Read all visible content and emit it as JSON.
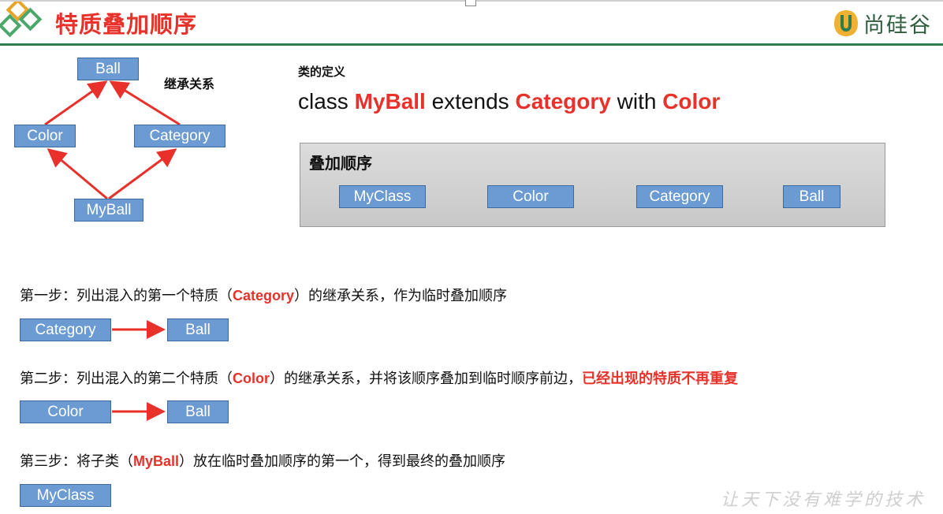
{
  "header": {
    "title": "特质叠加顺序",
    "brand": "尚硅谷"
  },
  "inheritance": {
    "label": "继承关系",
    "nodes": {
      "ball": "Ball",
      "color": "Color",
      "category": "Category",
      "myball": "MyBall"
    }
  },
  "definition": {
    "label": "类的定义",
    "parts": [
      "class ",
      "MyBall",
      " extends ",
      "Category",
      " with ",
      "Color"
    ]
  },
  "order": {
    "title": "叠加顺序",
    "items": [
      "MyClass",
      "Color",
      "Category",
      "Ball"
    ]
  },
  "step1": {
    "text_pre": "第一步：列出混入的第一个特质（",
    "highlight": "Category",
    "text_post": "）的继承关系，作为临时叠加顺序",
    "items": [
      "Category",
      "Ball"
    ]
  },
  "step2": {
    "text_pre": "第二步：列出混入的第二个特质（",
    "highlight": "Color",
    "text_post": "）的继承关系，并将该顺序叠加到临时顺序前边，",
    "emphasis": "已经出现的特质不再重复",
    "items": [
      "Color",
      "Ball"
    ]
  },
  "step3": {
    "text_pre": "第三步：将子类（",
    "highlight": "MyBall",
    "text_post": "）放在临时叠加顺序的第一个，得到最终的叠加顺序",
    "items": [
      "MyClass"
    ]
  },
  "watermark": "让天下没有难学的技术",
  "colors": {
    "accent_red": "#e8312a",
    "box_fill": "#6b9bd2",
    "box_border": "#3b6aa0",
    "brand_green": "#2e7d4f"
  }
}
